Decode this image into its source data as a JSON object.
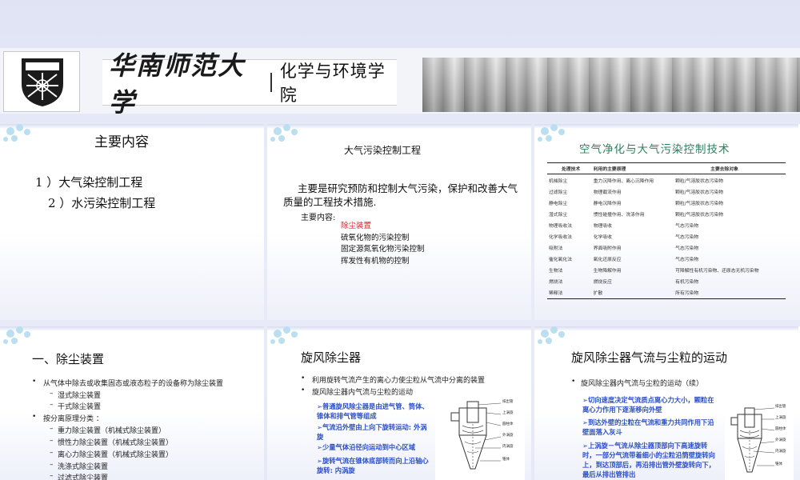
{
  "banner": {
    "university": "华南师范大学",
    "school": "化学与环境学院"
  },
  "slide1": {
    "title": "主要内容",
    "items": [
      "1 ）大气染控制工程",
      "2 ）水污染控制工程"
    ]
  },
  "slide2": {
    "title": "大气污染控制工程",
    "main": "主要是研究预防和控制大气污染，保护和改善大气质量的工程技术措施.",
    "sub": "主要内容:",
    "list": [
      "除尘装置",
      "硫氧化物的污染控制",
      "固定源氮氧化物污染控制",
      "挥发性有机物的控制"
    ]
  },
  "slide3": {
    "title": "空气净化与大气污染控制技术",
    "headers": [
      "处理技术",
      "利用的主要原理",
      "主要去除对象"
    ],
    "rows": [
      [
        "机械除尘",
        "重力沉降作用、离心沉降作用",
        "颗粒/气溶胶状态污染物"
      ],
      [
        "过滤除尘",
        "物理截流作用",
        "颗粒/气溶胶状态污染物"
      ],
      [
        "静电除尘",
        "静电沉降作用",
        "颗粒/气溶胶状态污染物"
      ],
      [
        "湿式除尘",
        "惯性碰撞作用、洗涤作用",
        "颗粒/气溶胶状态污染物"
      ],
      [
        "物理吸收法",
        "物理吸收",
        "气态污染物"
      ],
      [
        "化学吸收法",
        "化学吸收",
        "气态污染物"
      ],
      [
        "吸附法",
        "界面吸附作用",
        "气态污染物"
      ],
      [
        "催化氧化法",
        "氧化还原反应",
        "气态污染物"
      ],
      [
        "生物法",
        "生物降解作用",
        "可降解性有机污染物、还原态无机污染物"
      ],
      [
        "燃烧法",
        "燃烧反应",
        "有机污染物"
      ],
      [
        "稀释法",
        "扩散",
        "所有污染物"
      ]
    ]
  },
  "slide4": {
    "title": "一、除尘装置",
    "bullet1": "从气体中除去或收集固态或液态粒子的设备称为除尘装置",
    "sub1": [
      "湿式除尘装置",
      "干式除尘装置"
    ],
    "bullet2": "按分离原理分类 ：",
    "sub2": [
      "重力除尘装置（机械式除尘装置）",
      "惯性力除尘装置（机械式除尘装置）",
      "离心力除尘装置（机械式除尘装置）",
      "洗涤式除尘装置",
      "过滤式除尘装置"
    ]
  },
  "slide5": {
    "title": "旋风除尘器",
    "bullets": [
      "利用旋转气流产生的离心力使尘粒从气流中分离的装置",
      "旋风除尘器内气流与尘粒的运动"
    ],
    "points": [
      "➢普通旋风除尘器是由进气管、筒体、锥体和排气管等组成",
      "➢气流沿外壁由上向下旋转运动: 外涡旋",
      "➢少量气体沿径向运动到中心区域",
      "➢旋转气流在锥体底部转而向上沿轴心旋转: 内涡旋"
    ],
    "diagram_labels": [
      "排出管",
      "上涡旋",
      "圆柱体",
      "外涡旋",
      "内涡旋",
      "锥体"
    ]
  },
  "slide6": {
    "title": "旋风除尘器气流与尘粒的运动",
    "bullet": "旋风除尘器内气流与尘粒的运动（续）",
    "points": [
      "➢切向速度决定气流质点离心力大小，颗粒在离心力作用下逐渐移向外壁",
      "➢到达外壁的尘粒在气流和重力共同作用下沿壁面落入灰斗",
      "➢上涡旋－气流从除尘器顶部向下高速旋转时，一部分气流带着细小的尘粒沿筒壁旋转向上，到达顶部后，再沿排出管外壁旋转向下，最后从排出管排出"
    ],
    "diagram_labels": [
      "排出管",
      "上涡旋",
      "圆柱体",
      "外涡旋",
      "内涡旋",
      "锥体"
    ]
  },
  "colors": {
    "accent_blue": "#2b4fc7",
    "highlight_red": "#d2232a",
    "title_green": "#2d7f5f",
    "dot_blue": "#b9dff0"
  }
}
